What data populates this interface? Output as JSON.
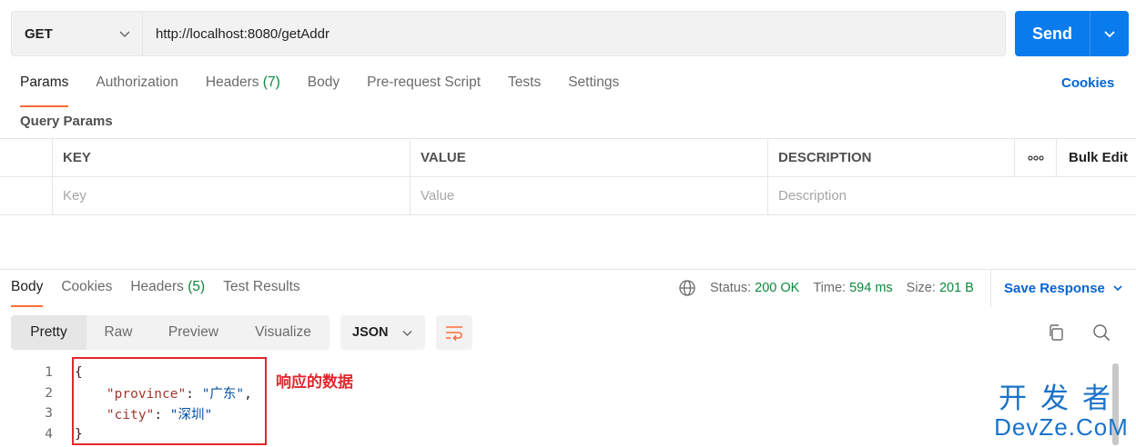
{
  "request": {
    "method": "GET",
    "url": "http://localhost:8080/getAddr",
    "send_label": "Send"
  },
  "request_tabs": [
    {
      "label": "Params",
      "count": ""
    },
    {
      "label": "Authorization",
      "count": ""
    },
    {
      "label": "Headers",
      "count": "(7)"
    },
    {
      "label": "Body",
      "count": ""
    },
    {
      "label": "Pre-request Script",
      "count": ""
    },
    {
      "label": "Tests",
      "count": ""
    },
    {
      "label": "Settings",
      "count": ""
    }
  ],
  "cookies_link": "Cookies",
  "query_params": {
    "title": "Query Params",
    "headers": {
      "key": "KEY",
      "value": "VALUE",
      "description": "DESCRIPTION",
      "more": "ooo",
      "bulk_edit": "Bulk Edit"
    },
    "placeholders": {
      "key": "Key",
      "value": "Value",
      "description": "Description"
    }
  },
  "response_tabs": [
    {
      "label": "Body",
      "count": ""
    },
    {
      "label": "Cookies",
      "count": ""
    },
    {
      "label": "Headers",
      "count": "(5)"
    },
    {
      "label": "Test Results",
      "count": ""
    }
  ],
  "status": {
    "status_label": "Status:",
    "status_value": "200 OK",
    "time_label": "Time:",
    "time_value": "594 ms",
    "size_label": "Size:",
    "size_value": "201 B"
  },
  "save_response": "Save Response",
  "view_modes": [
    "Pretty",
    "Raw",
    "Preview",
    "Visualize"
  ],
  "format": "JSON",
  "code_lines": [
    {
      "n": "1",
      "text": "{"
    },
    {
      "n": "2",
      "key": "\"province\"",
      "sep": ": ",
      "val": "\"广东\"",
      "tail": ","
    },
    {
      "n": "3",
      "key": "\"city\"",
      "sep": ": ",
      "val": "\"深圳\"",
      "tail": ""
    },
    {
      "n": "4",
      "text": "}"
    }
  ],
  "annotation": "响应的数据",
  "watermark": {
    "cn": "开发者",
    "en": "DevZe.CoM"
  },
  "colors": {
    "accent": "#ff6c37",
    "send": "#097bed",
    "link": "#0265d2",
    "status_ok": "#0a8a3a",
    "annotation": "#e0282e"
  }
}
